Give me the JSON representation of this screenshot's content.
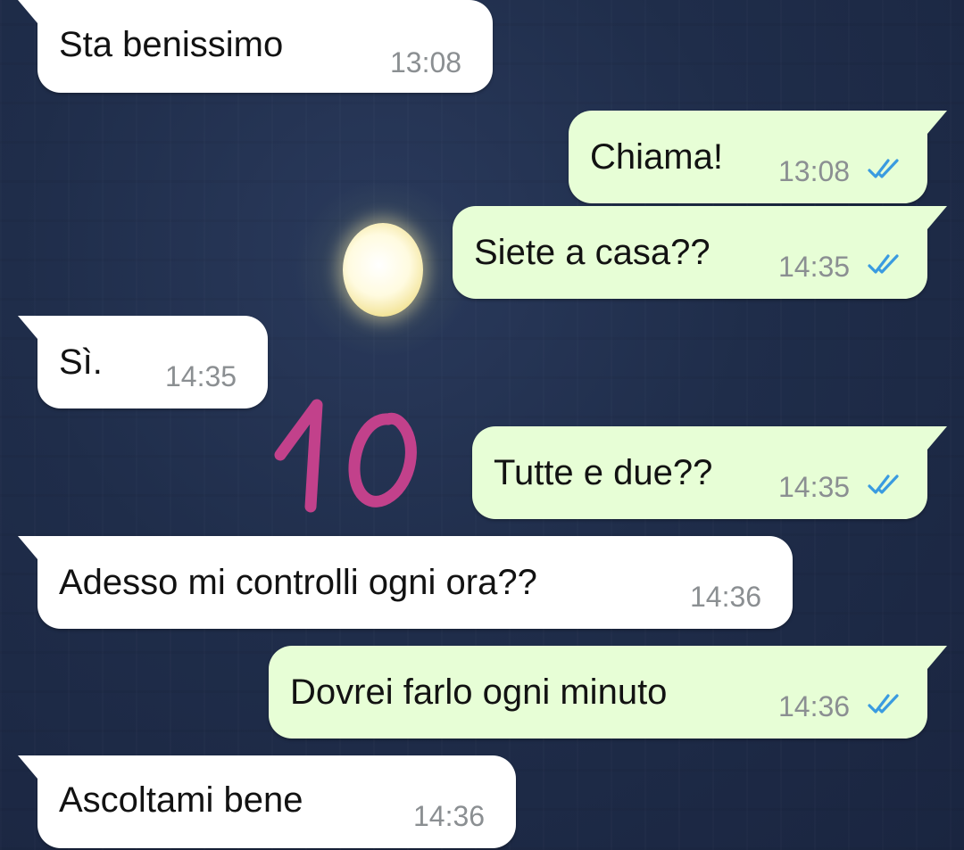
{
  "messages": [
    {
      "direction": "incoming",
      "text": "Sta benissimo",
      "time": "13:08"
    },
    {
      "direction": "outgoing",
      "text": "Chiama!",
      "time": "13:08",
      "status": "read"
    },
    {
      "direction": "outgoing",
      "text": "Siete a casa??",
      "time": "14:35",
      "status": "read"
    },
    {
      "direction": "incoming",
      "text": "Sì.",
      "time": "14:35"
    },
    {
      "direction": "outgoing",
      "text": "Tutte e due??",
      "time": "14:35",
      "status": "read"
    },
    {
      "direction": "incoming",
      "text": "Adesso mi controlli ogni ora??",
      "time": "14:36"
    },
    {
      "direction": "outgoing",
      "text": "Dovrei farlo ogni minuto",
      "time": "14:36",
      "status": "read"
    },
    {
      "direction": "incoming",
      "text": "Ascoltami bene",
      "time": "14:36"
    }
  ],
  "annotation": {
    "text": "10",
    "color": "#c2418b"
  },
  "colors": {
    "incoming_bubble": "#ffffff",
    "outgoing_bubble": "#e7fed6",
    "read_tick": "#3a9be0",
    "timestamp": "#8b8f92",
    "background": "#1f2d4a"
  },
  "icons": {
    "read_receipt": "double-check-icon"
  }
}
